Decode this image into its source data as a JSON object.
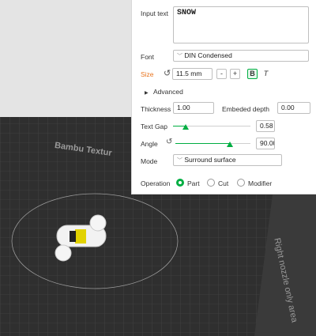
{
  "canvas": {
    "plate_label": "Bambu Textur",
    "nozzle_note": "Right nozzle only area"
  },
  "panel": {
    "input_text": {
      "label": "Input text",
      "value": "SNOW"
    },
    "font": {
      "label": "Font",
      "value": "DIN Condensed"
    },
    "size": {
      "label": "Size",
      "value": "11.5 mm",
      "minus": "-",
      "plus": "+",
      "bold": "B",
      "italic": "T"
    },
    "advanced": {
      "label": "Advanced"
    },
    "thickness": {
      "label": "Thickness",
      "value": "1.00"
    },
    "embeded_depth": {
      "label": "Embeded depth",
      "value": "0.00"
    },
    "text_gap": {
      "label": "Text Gap",
      "value": "0.58",
      "fraction": 0.16
    },
    "angle": {
      "label": "Angle",
      "value": "90.00",
      "fraction": 0.73
    },
    "mode": {
      "label": "Mode",
      "value": "Surround surface"
    },
    "operation": {
      "label": "Operation",
      "options": [
        "Part",
        "Cut",
        "Modifier"
      ],
      "selected": "Part"
    }
  },
  "colors": {
    "accent": "#00ae42",
    "size_label": "#e8731c",
    "panel_bg": "#ffffff",
    "plate": "#2e2e2e"
  }
}
